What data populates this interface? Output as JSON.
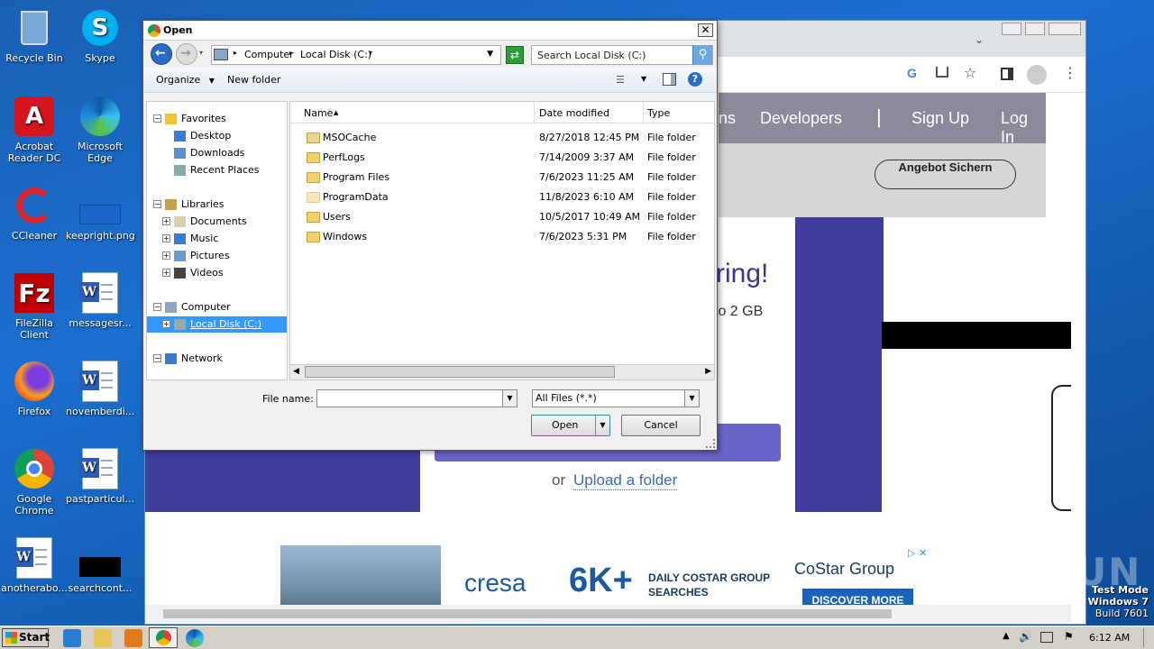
{
  "desktop": {
    "icons": [
      {
        "label": "Recycle Bin"
      },
      {
        "label": "Skype"
      },
      {
        "label": "Acrobat Reader DC"
      },
      {
        "label": "Microsoft Edge"
      },
      {
        "label": "CCleaner"
      },
      {
        "label": "keepright.png"
      },
      {
        "label": "FileZilla Client"
      },
      {
        "label": "messagesr..."
      },
      {
        "label": "Firefox"
      },
      {
        "label": "novemberdi..."
      },
      {
        "label": "Google Chrome"
      },
      {
        "label": "pastparticul..."
      },
      {
        "label": "anotherabo..."
      },
      {
        "label": "searchcont..."
      }
    ]
  },
  "browser": {
    "nav": {
      "developers": "Developers",
      "signup": "Sign Up",
      "login": "Log In",
      "partial": "ns"
    },
    "cta": "Angebot Sichern",
    "card": {
      "heading_partial": "ring!",
      "subtext_partial": "to 2 GB",
      "or": "or",
      "upload_folder": "Upload a folder"
    },
    "ad": {
      "brand": "cresa",
      "big": "6K+",
      "line1": "DAILY COSTAR GROUP",
      "line2": "SEARCHES",
      "costar": "CoStar Group",
      "discover": "DISCOVER MORE"
    }
  },
  "dialog": {
    "title": "Open",
    "breadcrumb": [
      "Computer",
      "Local Disk (C:)"
    ],
    "search_placeholder": "Search Local Disk (C:)",
    "toolbar": {
      "organize": "Organize",
      "new_folder": "New folder"
    },
    "nav_tree": [
      {
        "label": "Favorites",
        "level": 0
      },
      {
        "label": "Desktop",
        "level": 1
      },
      {
        "label": "Downloads",
        "level": 1
      },
      {
        "label": "Recent Places",
        "level": 1
      },
      {
        "label": "Libraries",
        "level": 0
      },
      {
        "label": "Documents",
        "level": 1
      },
      {
        "label": "Music",
        "level": 1
      },
      {
        "label": "Pictures",
        "level": 1
      },
      {
        "label": "Videos",
        "level": 1
      },
      {
        "label": "Computer",
        "level": 0
      },
      {
        "label": "Local Disk (C:)",
        "level": 1,
        "selected": true
      },
      {
        "label": "Network",
        "level": 0
      }
    ],
    "columns": {
      "name": "Name",
      "date": "Date modified",
      "type": "Type"
    },
    "files": [
      {
        "name": "MSOCache",
        "date": "8/27/2018 12:45 PM",
        "type": "File folder"
      },
      {
        "name": "PerfLogs",
        "date": "7/14/2009 3:37 AM",
        "type": "File folder"
      },
      {
        "name": "Program Files",
        "date": "7/6/2023 11:25 AM",
        "type": "File folder"
      },
      {
        "name": "ProgramData",
        "date": "11/8/2023 6:10 AM",
        "type": "File folder"
      },
      {
        "name": "Users",
        "date": "10/5/2017 10:49 AM",
        "type": "File folder"
      },
      {
        "name": "Windows",
        "date": "7/6/2023 5:31 PM",
        "type": "File folder"
      }
    ],
    "file_name_label": "File name:",
    "file_name_value": "",
    "file_type": "All Files (*.*)",
    "open": "Open",
    "cancel": "Cancel"
  },
  "taskbar": {
    "start": "Start",
    "clock": "6:12 AM"
  },
  "watermark": {
    "line1": "Test Mode",
    "line2": "Windows 7",
    "line3": "Build 7601",
    "anyrun": "ANY RUN"
  }
}
